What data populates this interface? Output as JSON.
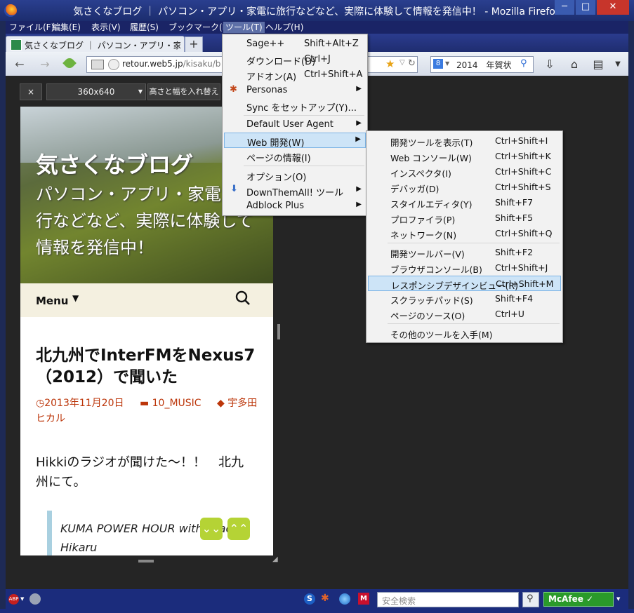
{
  "window": {
    "title": "気さくなブログ ｜ パソコン・アプリ・家電に旅行などなど、実際に体験して情報を発信中！ - Mozilla Firefox",
    "minimize": "─",
    "maximize": "□",
    "close": "✕"
  },
  "menubar": [
    "ファイル(F)",
    "編集(E)",
    "表示(V)",
    "履歴(S)",
    "ブックマーク(B)",
    "ツール(T)",
    "ヘルプ(H)"
  ],
  "tab": {
    "label": "気さくなブログ ｜ パソコン・アプリ・家電に旅行... ×",
    "new_tab": "+"
  },
  "navbar": {
    "back": "←",
    "forward": "→",
    "url_host": "retour.web5.jp",
    "url_path": "/kisaku/b",
    "search_engine": "8",
    "search_value": "2014　年賀状"
  },
  "rdv": {
    "close": "×",
    "size": "360x640",
    "rotate": "高さと幅を入れ替え"
  },
  "site": {
    "title": "気さくなブログ",
    "description": "パソコン・アプリ・家電に旅行などなど、実際に体験して情報を発信中！",
    "menu": "Menu",
    "menu_arrow": "▼"
  },
  "post": {
    "title": "北九州でInterFMをNexus7（2012）で聞いた",
    "date": "2013年11月20日",
    "category": "10_MUSIC",
    "tag": "宇多田ヒカル",
    "body": "Hikkiのラジオが聞けた〜！！　北九州にて。",
    "quote": "KUMA POWER HOUR with Utada Hikaru"
  },
  "tools_menu": [
    {
      "label": "Sage++",
      "key": "Shift+Alt+Z",
      "sub": ""
    },
    {
      "label": "ダウンロード(D)",
      "key": "Ctrl+J",
      "sub": ""
    },
    {
      "label": "アドオン(A)",
      "key": "Ctrl+Shift+A",
      "sub": ""
    },
    {
      "label": "Personas",
      "key": "",
      "sub": "▶"
    },
    {
      "label": "Sync をセットアップ(Y)...",
      "key": "",
      "sub": ""
    },
    {
      "label": "Default User Agent",
      "key": "",
      "sub": "▶"
    },
    {
      "label": "Web 開発(W)",
      "key": "",
      "sub": "▶"
    },
    {
      "label": "ページの情報(I)",
      "key": "",
      "sub": ""
    },
    {
      "label": "オプション(O)",
      "key": "",
      "sub": ""
    },
    {
      "label": "DownThemAll! ツール",
      "key": "",
      "sub": "▶"
    },
    {
      "label": "Adblock Plus",
      "key": "",
      "sub": "▶"
    }
  ],
  "webdev_menu": [
    {
      "label": "開発ツールを表示(T)",
      "key": "Ctrl+Shift+I"
    },
    {
      "label": "Web コンソール(W)",
      "key": "Ctrl+Shift+K"
    },
    {
      "label": "インスペクタ(I)",
      "key": "Ctrl+Shift+C"
    },
    {
      "label": "デバッガ(D)",
      "key": "Ctrl+Shift+S"
    },
    {
      "label": "スタイルエディタ(Y)",
      "key": "Shift+F7"
    },
    {
      "label": "プロファイラ(P)",
      "key": "Shift+F5"
    },
    {
      "label": "ネットワーク(N)",
      "key": "Ctrl+Shift+Q"
    },
    {
      "label": "開発ツールバー(V)",
      "key": "Shift+F2"
    },
    {
      "label": "ブラウザコンソール(B)",
      "key": "Ctrl+Shift+J"
    },
    {
      "label": "レスポンシブデザインビュー(R)",
      "key": "Ctrl+Shift+M"
    },
    {
      "label": "スクラッチパッド(S)",
      "key": "Shift+F4"
    },
    {
      "label": "ページのソース(O)",
      "key": "Ctrl+U"
    },
    {
      "label": "その他のツールを入手(M)",
      "key": ""
    }
  ],
  "statusbar": {
    "abp": "ABP",
    "search_placeholder": "安全検索",
    "mcafee": "McAfee ✓"
  },
  "colors": {
    "highlight": "#cde4f7",
    "meta": "#bc360a",
    "scroll_btn": "#b5d335"
  }
}
